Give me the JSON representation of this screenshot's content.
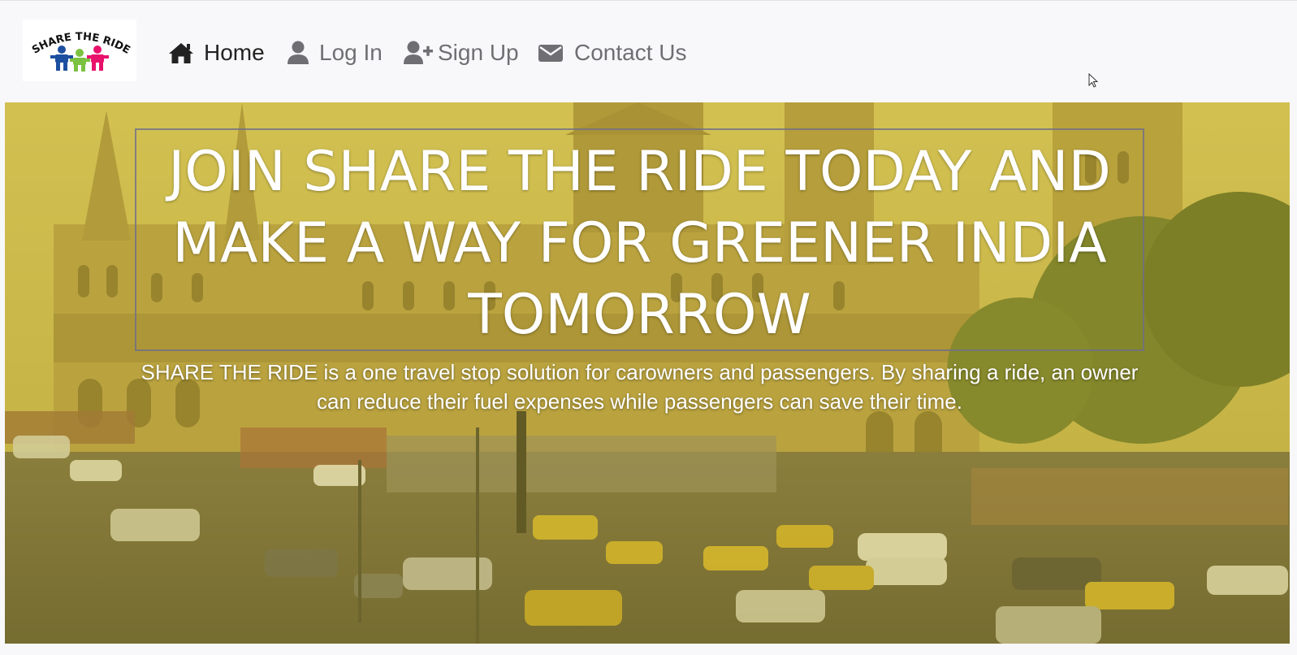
{
  "logo": {
    "text": "SHARE THE RIDE",
    "figure_colors": [
      "#1d4fa0",
      "#7cc242",
      "#e8116c"
    ]
  },
  "nav": {
    "items": [
      {
        "label": "Home",
        "icon": "home-icon",
        "active": true
      },
      {
        "label": "Log In",
        "icon": "user-icon",
        "active": false
      },
      {
        "label": "Sign Up",
        "icon": "user-plus-icon",
        "active": false
      },
      {
        "label": "Contact Us",
        "icon": "envelope-icon",
        "active": false
      }
    ]
  },
  "hero": {
    "title": "JOIN SHARE THE RIDE TODAY AND MAKE A WAY FOR GREENER INDIA TOMORROW",
    "description": "SHARE THE RIDE is a one travel stop solution for carowners and passengers. By sharing a ride, an owner can reduce their fuel expenses while passengers can save their time.",
    "overlay_color": "#c8b428"
  },
  "colors": {
    "nav_background": "#f8f8fa",
    "nav_active": "#222222",
    "nav_inactive": "#6f6f73"
  }
}
